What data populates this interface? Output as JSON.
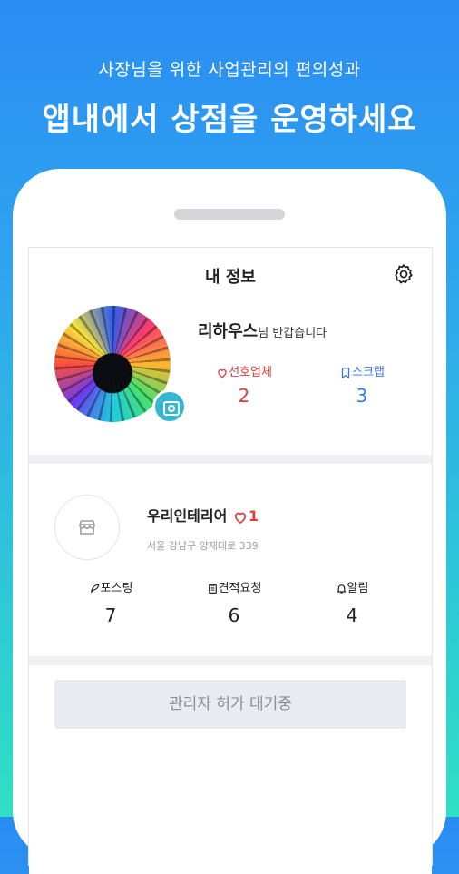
{
  "promo": {
    "subtitle": "사장님을 위한 사업관리의 편의성과",
    "title": "앱내에서 상점을 운영하세요"
  },
  "header": {
    "title": "내 정보"
  },
  "profile": {
    "name": "리하우스",
    "greeting": "님 반갑습니다",
    "favorites": {
      "label": "선호업체",
      "value": "2"
    },
    "scraps": {
      "label": "스크랩",
      "value": "3"
    }
  },
  "shop": {
    "name": "우리인테리어",
    "likes": "1",
    "address": "서울 강남구 양재대로 339",
    "stats": [
      {
        "label": "포스팅",
        "value": "7",
        "icon": "feather-icon"
      },
      {
        "label": "견적요청",
        "value": "6",
        "icon": "clipboard-icon"
      },
      {
        "label": "알림",
        "value": "4",
        "icon": "bell-icon"
      }
    ]
  },
  "pending": {
    "label": "관리자 허가 대기중"
  },
  "colors": {
    "accent_red": "#e23a3a",
    "accent_blue": "#3a76e8",
    "camera": "#34b7cf"
  }
}
